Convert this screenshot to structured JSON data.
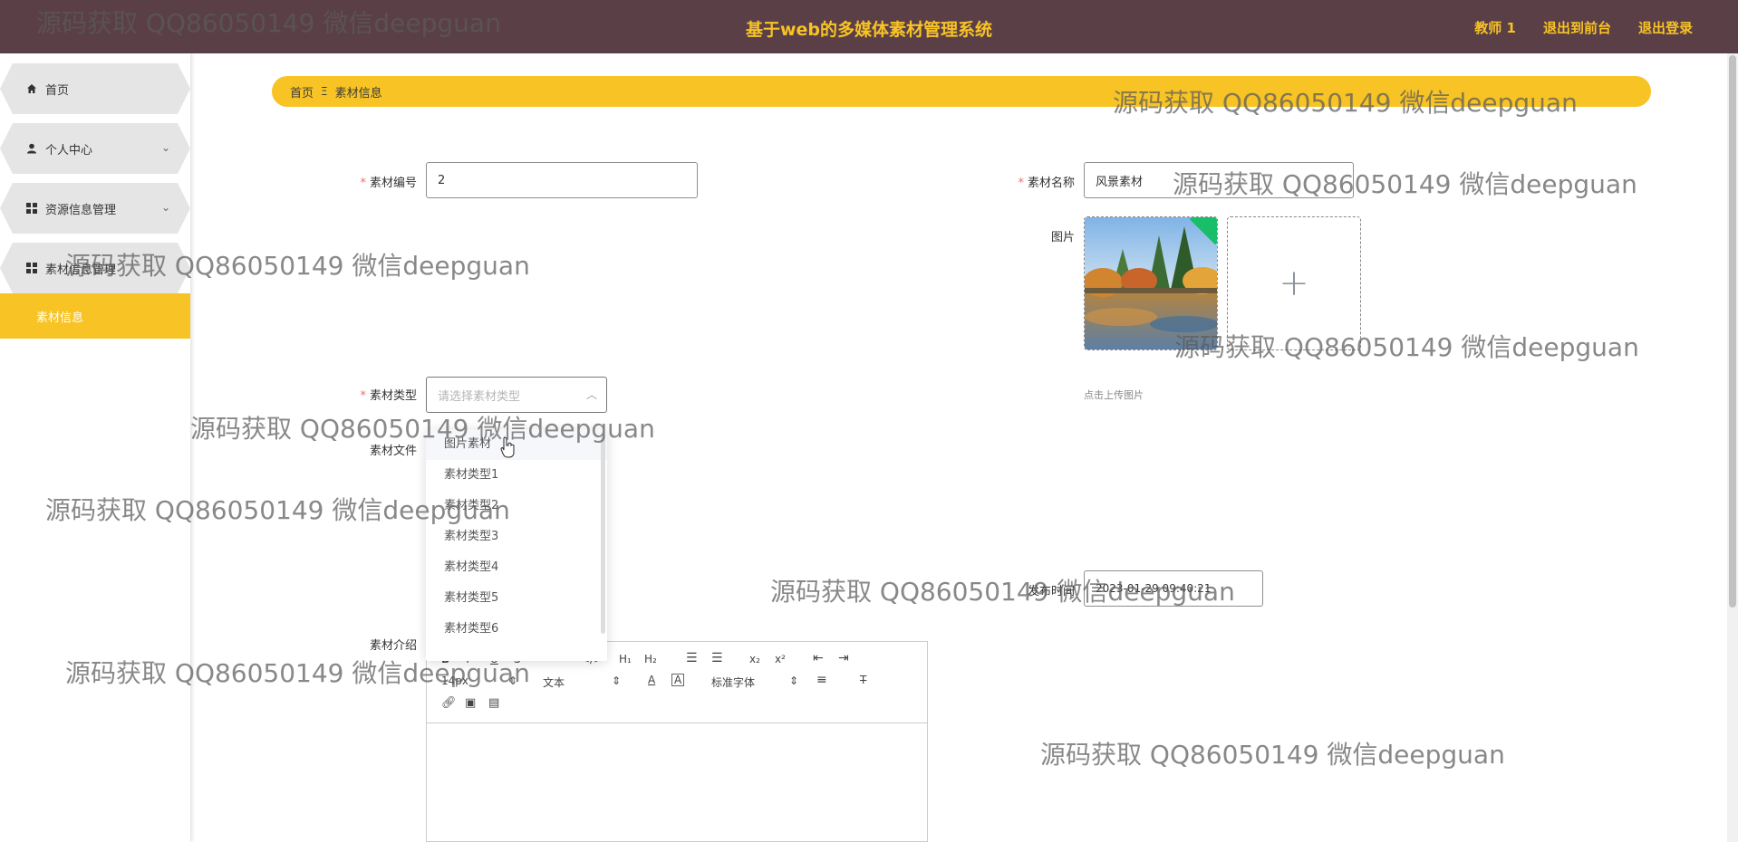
{
  "header": {
    "title": "基于web的多媒体素材管理系统",
    "user": "教师 1",
    "back_front": "退出到前台",
    "logout": "退出登录"
  },
  "sidebar": {
    "items": [
      {
        "label": "首页",
        "icon": "home-icon"
      },
      {
        "label": "个人中心",
        "icon": "user-icon"
      },
      {
        "label": "资源信息管理",
        "icon": "grid-icon"
      },
      {
        "label": "素材信息管理",
        "icon": "grid-icon"
      }
    ],
    "active_sub": "素材信息"
  },
  "breadcrumb": {
    "home": "首页",
    "sep": "Ξ",
    "current": "素材信息"
  },
  "form": {
    "code_label": "素材编号",
    "code_value": "2",
    "name_label": "素材名称",
    "name_value": "风景素材",
    "image_label": "图片",
    "upload_tip": "点击上传图片",
    "type_label": "素材类型",
    "type_placeholder": "请选择素材类型",
    "file_label": "素材文件",
    "time_label": "发布时间",
    "time_value": "2023-01-29 09:40:21",
    "intro_label": "素材介绍"
  },
  "type_options": [
    "图片素材",
    "素材类型1",
    "素材类型2",
    "素材类型3",
    "素材类型4",
    "素材类型5",
    "素材类型6"
  ],
  "editor": {
    "font_size": "14px",
    "paragraph": "文本",
    "font_family": "标准字体"
  },
  "watermark": "源码获取 QQ86050149 微信deepguan",
  "colors": {
    "topbar": "#5b3f47",
    "accent": "#f7c325",
    "required": "#f56c6c"
  }
}
